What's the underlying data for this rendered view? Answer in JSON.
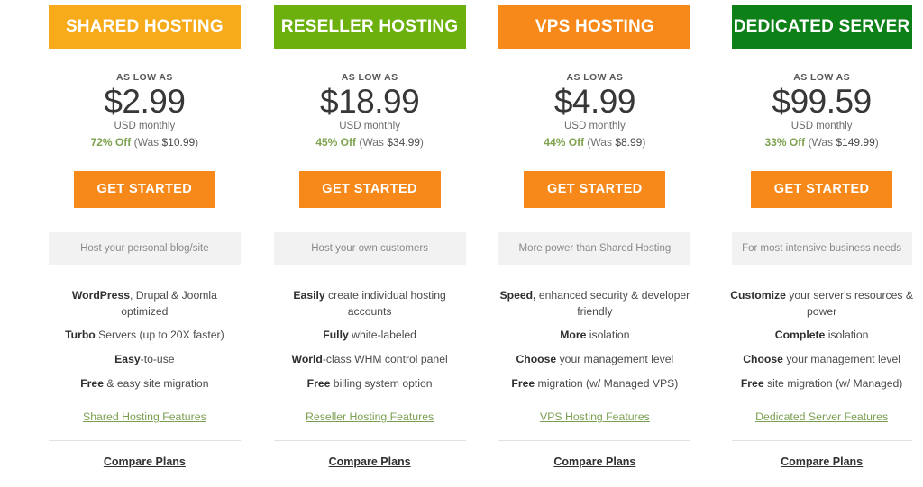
{
  "colors": {
    "shared_header": "#f7ab1b",
    "reseller_header": "#6cb00d",
    "vps_header": "#f7891a",
    "dedicated_header": "#0e8018",
    "cta": "#f7891a",
    "discount_green": "#7ea24f",
    "features_link": "#7b9f52",
    "tagline_bg": "#f2f2f2"
  },
  "plans": [
    {
      "id": "shared-hosting",
      "title": "SHARED HOSTING",
      "header_color": "#f7ab1b",
      "as_low_as": "AS LOW AS",
      "price": "$2.99",
      "period": "USD monthly",
      "discount_pct": "72% Off",
      "discount_was_prefix": " (Was ",
      "discount_was_amount": "$10.99",
      "discount_was_suffix": ")",
      "cta_label": "GET STARTED",
      "tagline": "Host your personal blog/site",
      "features": [
        {
          "bold": "WordPress",
          "rest": ", Drupal & Joomla optimized"
        },
        {
          "bold": "Turbo",
          "rest": " Servers (up to 20X faster)"
        },
        {
          "bold": "Easy",
          "rest": "-to-use"
        },
        {
          "bold": "Free",
          "rest": " & easy site migration"
        }
      ],
      "features_link": "Shared Hosting Features",
      "compare_link": "Compare Plans"
    },
    {
      "id": "reseller-hosting",
      "title": "RESELLER HOSTING",
      "header_color": "#6cb00d",
      "as_low_as": "AS LOW AS",
      "price": "$18.99",
      "period": "USD monthly",
      "discount_pct": "45% Off",
      "discount_was_prefix": " (Was ",
      "discount_was_amount": "$34.99",
      "discount_was_suffix": ")",
      "cta_label": "GET STARTED",
      "tagline": "Host your own customers",
      "features": [
        {
          "bold": "Easily",
          "rest": " create individual hosting accounts"
        },
        {
          "bold": "Fully",
          "rest": " white-labeled"
        },
        {
          "bold": "World",
          "rest": "-class WHM control panel"
        },
        {
          "bold": "Free",
          "rest": " billing system option"
        }
      ],
      "features_link": "Reseller Hosting Features",
      "compare_link": "Compare Plans"
    },
    {
      "id": "vps-hosting",
      "title": "VPS HOSTING",
      "header_color": "#f7891a",
      "as_low_as": "AS LOW AS",
      "price": "$4.99",
      "period": "USD monthly",
      "discount_pct": "44% Off",
      "discount_was_prefix": " (Was ",
      "discount_was_amount": "$8.99",
      "discount_was_suffix": ")",
      "cta_label": "GET STARTED",
      "tagline": "More power than Shared Hosting",
      "features": [
        {
          "bold": "Speed,",
          "rest": " enhanced security & developer friendly"
        },
        {
          "bold": "More",
          "rest": " isolation"
        },
        {
          "bold": "Choose",
          "rest": " your management level"
        },
        {
          "bold": "Free",
          "rest": " migration (w/ Managed VPS)"
        }
      ],
      "features_link": "VPS Hosting Features",
      "compare_link": "Compare Plans"
    },
    {
      "id": "dedicated-server",
      "title": "DEDICATED SERVER",
      "header_color": "#0e8018",
      "as_low_as": "AS LOW AS",
      "price": "$99.59",
      "period": "USD monthly",
      "discount_pct": "33% Off",
      "discount_was_prefix": " (Was ",
      "discount_was_amount": "$149.99",
      "discount_was_suffix": ")",
      "cta_label": "GET STARTED",
      "tagline": "For most intensive business needs",
      "features": [
        {
          "bold": "Customize",
          "rest": " your server's resources & power"
        },
        {
          "bold": "Complete",
          "rest": " isolation"
        },
        {
          "bold": "Choose",
          "rest": " your management level"
        },
        {
          "bold": "Free",
          "rest": " site migration (w/ Managed)"
        }
      ],
      "features_link": "Dedicated Server Features",
      "compare_link": "Compare Plans"
    }
  ]
}
